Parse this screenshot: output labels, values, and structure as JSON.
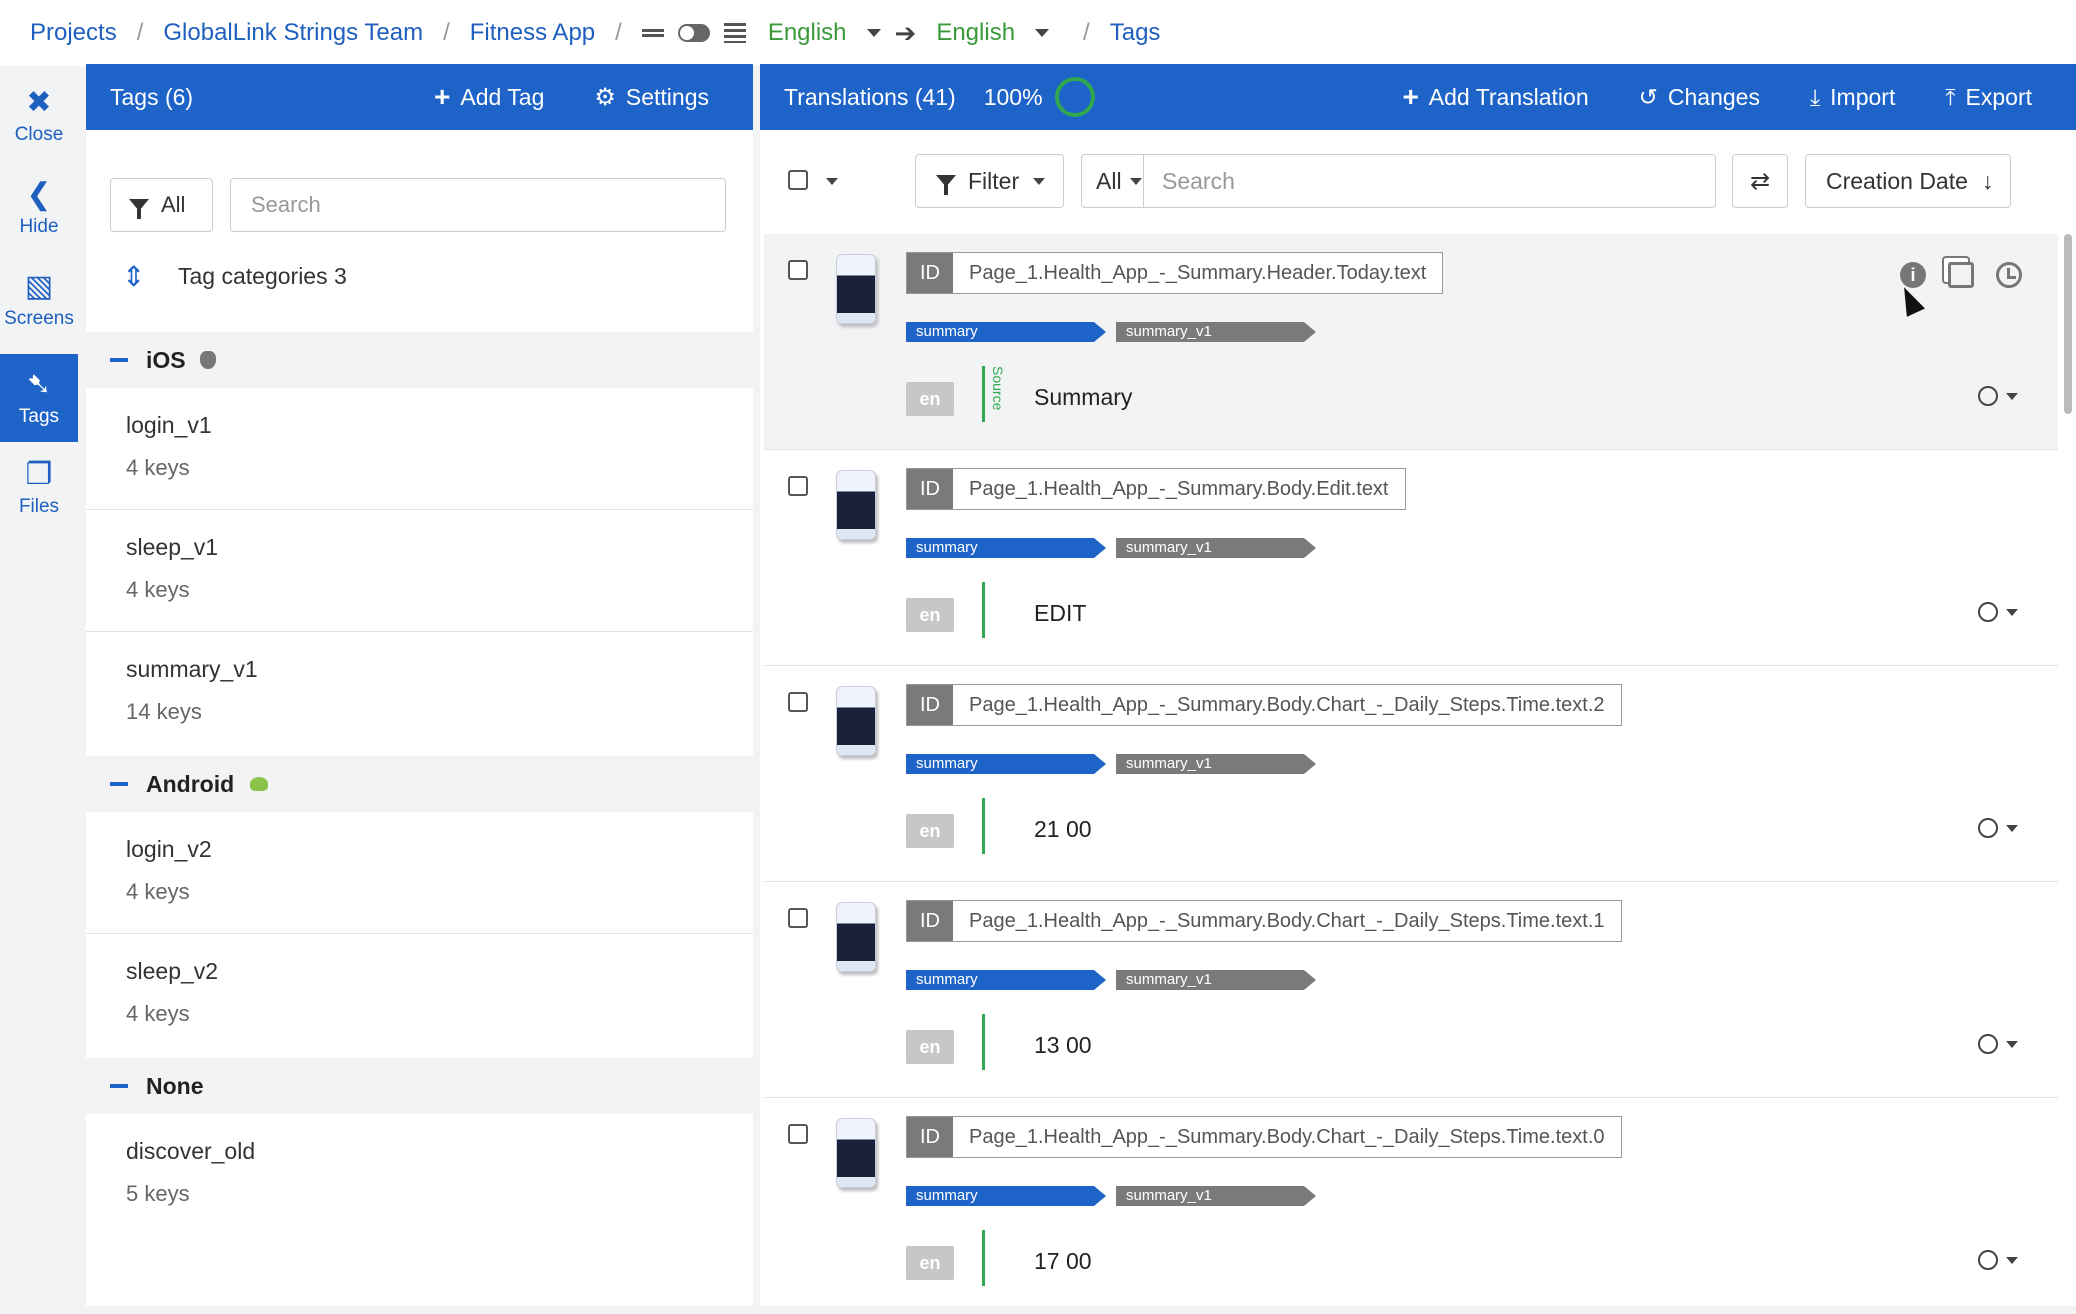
{
  "breadcrumb": {
    "projects": "Projects",
    "team": "GlobalLink Strings Team",
    "app": "Fitness App",
    "source_lang": "English",
    "target_lang": "English",
    "current": "Tags"
  },
  "leftnav": {
    "close": "Close",
    "hide": "Hide",
    "screens": "Screens",
    "tags": "Tags",
    "files": "Files"
  },
  "tags_panel": {
    "title": "Tags (6)",
    "add_tag": "Add Tag",
    "settings": "Settings",
    "filter_label": "All",
    "search_placeholder": "Search",
    "tag_categories": "Tag categories 3",
    "categories": [
      {
        "name": "iOS",
        "items": [
          {
            "name": "login_v1",
            "keys": "4 keys"
          },
          {
            "name": "sleep_v1",
            "keys": "4 keys"
          },
          {
            "name": "summary_v1",
            "keys": "14 keys"
          }
        ]
      },
      {
        "name": "Android",
        "items": [
          {
            "name": "login_v2",
            "keys": "4 keys"
          },
          {
            "name": "sleep_v2",
            "keys": "4 keys"
          }
        ]
      },
      {
        "name": "None",
        "items": [
          {
            "name": "discover_old",
            "keys": "5 keys"
          }
        ]
      }
    ]
  },
  "translations_panel": {
    "title": "Translations (41)",
    "progress": "100%",
    "add_translation": "Add Translation",
    "changes": "Changes",
    "import": "Import",
    "export": "Export",
    "filter": "Filter",
    "all": "All",
    "search_placeholder": "Search",
    "sort": "Creation Date"
  },
  "rows": [
    {
      "id_label": "ID",
      "key": "Page_1.Health_App_-_Summary.Header.Today.text",
      "tag1": "summary",
      "tag2": "summary_v1",
      "lang": "en",
      "source_label": "Source",
      "value": "Summary"
    },
    {
      "id_label": "ID",
      "key": "Page_1.Health_App_-_Summary.Body.Edit.text",
      "tag1": "summary",
      "tag2": "summary_v1",
      "lang": "en",
      "value": "EDIT"
    },
    {
      "id_label": "ID",
      "key": "Page_1.Health_App_-_Summary.Body.Chart_-_Daily_Steps.Time.text.2",
      "tag1": "summary",
      "tag2": "summary_v1",
      "lang": "en",
      "value": "21 00"
    },
    {
      "id_label": "ID",
      "key": "Page_1.Health_App_-_Summary.Body.Chart_-_Daily_Steps.Time.text.1",
      "tag1": "summary",
      "tag2": "summary_v1",
      "lang": "en",
      "value": "13 00"
    },
    {
      "id_label": "ID",
      "key": "Page_1.Health_App_-_Summary.Body.Chart_-_Daily_Steps.Time.text.0",
      "tag1": "summary",
      "tag2": "summary_v1",
      "lang": "en",
      "value": "17 00"
    }
  ],
  "colors": {
    "primary": "#1e63c8",
    "accent_green": "#2fa84f",
    "tag_gray": "#7a7a7a"
  }
}
